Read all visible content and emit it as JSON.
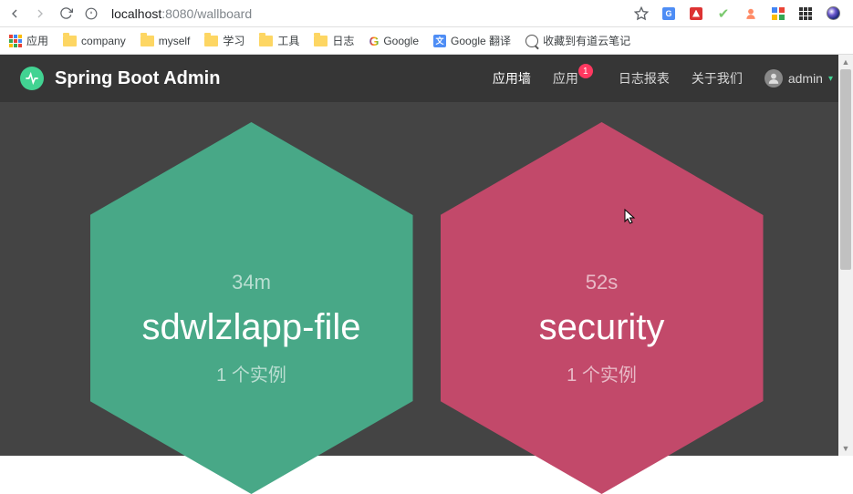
{
  "browser": {
    "url_host": "localhost",
    "url_port": ":8080",
    "url_path": "/wallboard"
  },
  "bookmarks": {
    "apps_label": "应用",
    "items": [
      {
        "label": "company",
        "type": "folder"
      },
      {
        "label": "myself",
        "type": "folder"
      },
      {
        "label": "学习",
        "type": "folder"
      },
      {
        "label": "工具",
        "type": "folder"
      },
      {
        "label": "日志",
        "type": "folder"
      },
      {
        "label": "Google",
        "type": "google"
      },
      {
        "label": "Google 翻译",
        "type": "translate"
      },
      {
        "label": "收藏到有道云笔记",
        "type": "youdao"
      }
    ]
  },
  "nav": {
    "brand": "Spring Boot Admin",
    "items": {
      "wallboard": "应用墙",
      "applications": "应用",
      "journal": "日志报表",
      "about": "关于我们"
    },
    "badge_count": "1",
    "user_name": "admin"
  },
  "apps": [
    {
      "id": "sdwlzlapp-file",
      "name": "sdwlzlapp-file",
      "uptime": "34m",
      "instances_text": "1 个实例",
      "status_color": "green"
    },
    {
      "id": "security",
      "name": "security",
      "uptime": "52s",
      "instances_text": "1 个实例",
      "status_color": "red"
    }
  ]
}
